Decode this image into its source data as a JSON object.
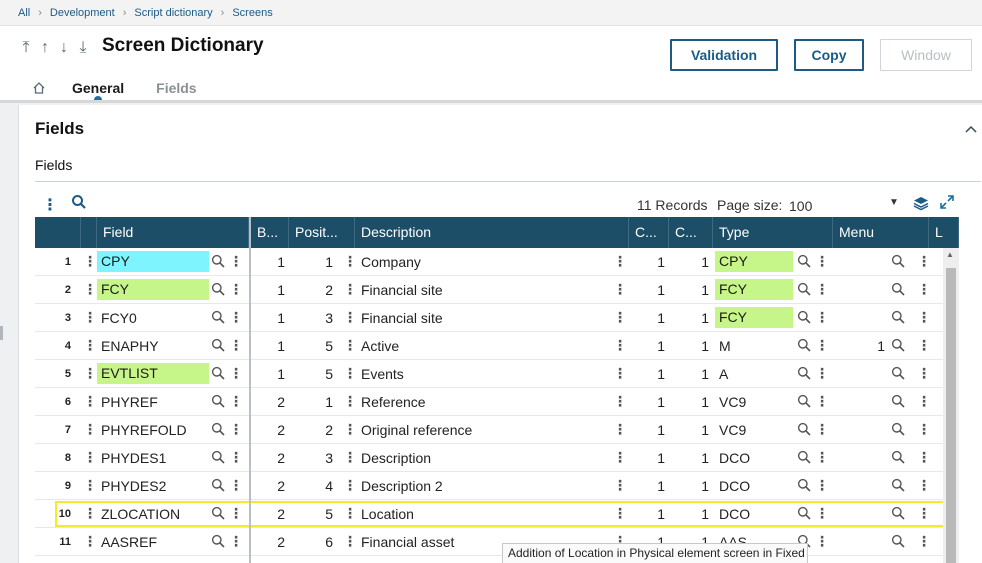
{
  "breadcrumb": [
    "All",
    "Development",
    "Script dictionary",
    "Screens"
  ],
  "header": {
    "title": "Screen Dictionary",
    "buttons": {
      "validation": "Validation",
      "copy": "Copy",
      "window": "Window"
    },
    "tabs": {
      "general": "General",
      "fields": "Fields"
    }
  },
  "section": {
    "title": "Fields",
    "subtitle": "Fields"
  },
  "toolbar": {
    "records": "11 Records",
    "page_size_label": "Page size:",
    "page_size_value": "100"
  },
  "grid": {
    "columns": [
      "Field",
      "B...",
      "Posit...",
      "Description",
      "C...",
      "C...",
      "Type",
      "Menu",
      "L"
    ],
    "rows": [
      {
        "n": "1",
        "field": "CPY",
        "b": "1",
        "pos": "1",
        "desc": "Company",
        "c1": "1",
        "c2": "1",
        "type": "CPY",
        "menu": ""
      },
      {
        "n": "2",
        "field": "FCY",
        "b": "1",
        "pos": "2",
        "desc": "Financial site",
        "c1": "1",
        "c2": "1",
        "type": "FCY",
        "menu": ""
      },
      {
        "n": "3",
        "field": "FCY0",
        "b": "1",
        "pos": "3",
        "desc": "Financial site",
        "c1": "1",
        "c2": "1",
        "type": "FCY",
        "menu": ""
      },
      {
        "n": "4",
        "field": "ENAPHY",
        "b": "1",
        "pos": "5",
        "desc": "Active",
        "c1": "1",
        "c2": "1",
        "type": "M",
        "menu": "1"
      },
      {
        "n": "5",
        "field": "EVTLIST",
        "b": "1",
        "pos": "5",
        "desc": "Events",
        "c1": "1",
        "c2": "1",
        "type": "A",
        "menu": ""
      },
      {
        "n": "6",
        "field": "PHYREF",
        "b": "2",
        "pos": "1",
        "desc": "Reference",
        "c1": "1",
        "c2": "1",
        "type": "VC9",
        "menu": ""
      },
      {
        "n": "7",
        "field": "PHYREFOLD",
        "b": "2",
        "pos": "2",
        "desc": "Original reference",
        "c1": "1",
        "c2": "1",
        "type": "VC9",
        "menu": ""
      },
      {
        "n": "8",
        "field": "PHYDES1",
        "b": "2",
        "pos": "3",
        "desc": "Description",
        "c1": "1",
        "c2": "1",
        "type": "DCO",
        "menu": ""
      },
      {
        "n": "9",
        "field": "PHYDES2",
        "b": "2",
        "pos": "4",
        "desc": "Description 2",
        "c1": "1",
        "c2": "1",
        "type": "DCO",
        "menu": ""
      },
      {
        "n": "10",
        "field": "ZLOCATION",
        "b": "2",
        "pos": "5",
        "desc": "Location",
        "c1": "1",
        "c2": "1",
        "type": "DCO",
        "menu": ""
      },
      {
        "n": "11",
        "field": "AASREF",
        "b": "2",
        "pos": "6",
        "desc": "Financial asset",
        "c1": "1",
        "c2": "1",
        "type": "AAS",
        "menu": ""
      }
    ],
    "field_highlight": [
      "cyan",
      "green",
      "",
      "",
      "green",
      "",
      "",
      "",
      "",
      "",
      ""
    ],
    "type_highlight": [
      "green",
      "green",
      "green",
      "",
      "",
      "",
      "",
      "",
      "",
      "",
      ""
    ],
    "selected_row": "10"
  },
  "tooltip": "Addition of Location in Physical element screen in Fixed",
  "colors": {
    "header_bg": "#1d4e67",
    "accent": "#1b5b86",
    "cyan": "#7df4ff",
    "green": "#c6f58a",
    "selection": "#f3ea2a"
  },
  "icons": [
    "home-icon",
    "search-icon",
    "more-vertical-icon",
    "layers-icon",
    "expand-icon",
    "chevron-up-icon"
  ]
}
